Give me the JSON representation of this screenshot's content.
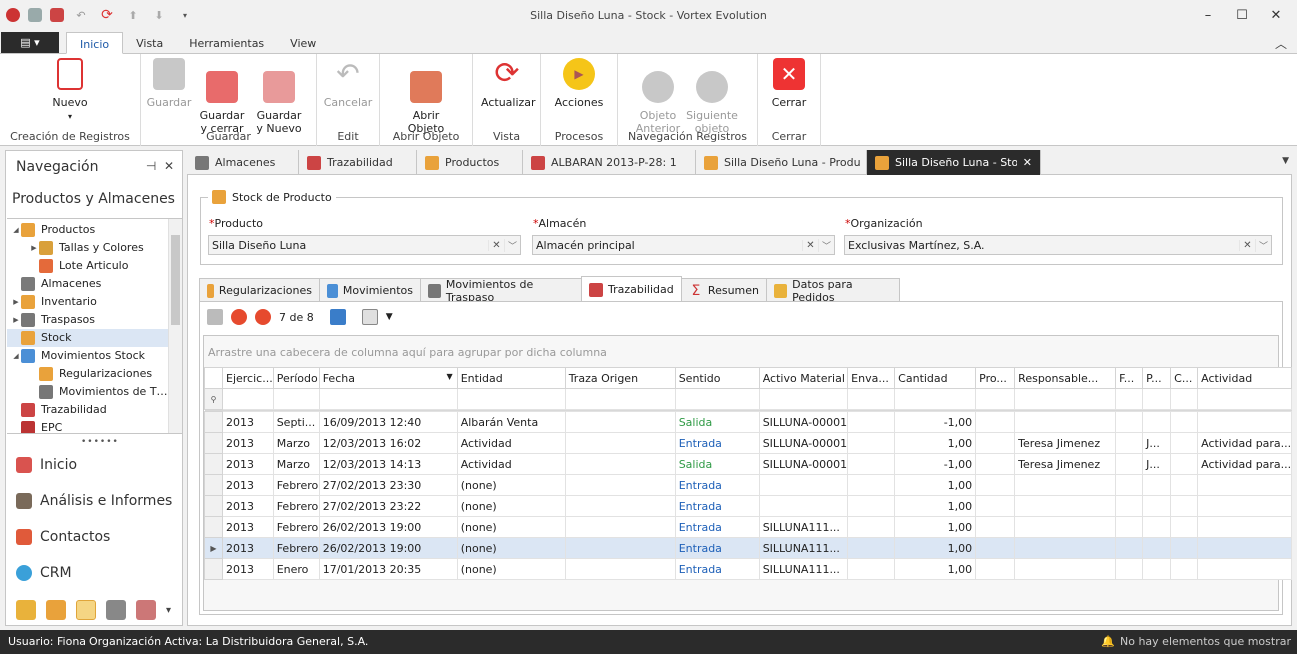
{
  "window": {
    "title": "Silla Diseño Luna - Stock - Vortex Evolution"
  },
  "menu": {
    "file_icon": "menu-icon",
    "tabs": [
      "Inicio",
      "Vista",
      "Herramientas",
      "View"
    ]
  },
  "ribbon": {
    "groups": [
      {
        "label": "Creación de Registros",
        "buttons": [
          "Nuevo"
        ]
      },
      {
        "label": "Guardar",
        "buttons": [
          "Guardar",
          "Guardar\ny cerrar",
          "Guardar\ny Nuevo"
        ]
      },
      {
        "label": "Edit",
        "buttons": [
          "Cancelar"
        ]
      },
      {
        "label": "Abrir Objeto",
        "buttons": [
          "Abrir\nObjeto"
        ]
      },
      {
        "label": "Vista",
        "buttons": [
          "Actualizar"
        ]
      },
      {
        "label": "Procesos",
        "buttons": [
          "Acciones"
        ]
      },
      {
        "label": "Navegación Registros",
        "buttons": [
          "Objeto\nAnterior",
          "Siguiente\nobjeto"
        ]
      },
      {
        "label": "Cerrar",
        "buttons": [
          "Cerrar"
        ]
      }
    ]
  },
  "nav": {
    "title": "Navegación",
    "section": "Productos y Almacenes",
    "tree": [
      "Productos",
      "Tallas y Colores",
      "Lote Articulo",
      "Almacenes",
      "Inventario",
      "Traspasos",
      "Stock",
      "Movimientos Stock",
      "Regularizaciones",
      "Movimientos de T…",
      "Trazabilidad",
      "EPC"
    ],
    "buttons": [
      "Inicio",
      "Análisis e Informes",
      "Contactos",
      "CRM"
    ]
  },
  "doc_tabs": [
    "Almacenes",
    "Trazabilidad",
    "Productos",
    "ALBARAN 2013-P-28: 1",
    "Silla Diseño Luna - Produ",
    "Silla Diseño Luna - Stock"
  ],
  "form": {
    "group_title": "Stock de Producto",
    "producto_label": "Producto",
    "producto_value": "Silla Diseño Luna",
    "almacen_label": "Almacén",
    "almacen_value": "Almacén principal",
    "org_label": "Organización",
    "org_value": "Exclusivas Martínez, S.A."
  },
  "sub_tabs": [
    "Regularizaciones",
    "Movimientos",
    "Movimientos de Traspaso",
    "Trazabilidad",
    "Resumen",
    "Datos para Pedidos"
  ],
  "grid": {
    "counter": "7 de 8",
    "group_hint": "Arrastre una cabecera de columna aquí para agrupar por dicha columna",
    "columns": [
      "Ejercic...",
      "Período",
      "Fecha",
      "Entidad",
      "Traza Origen",
      "Sentido",
      "Activo Material",
      "Enva...",
      "Cantidad",
      "Pro...",
      "Responsable...",
      "F...",
      "P...",
      "C...",
      "Actividad"
    ],
    "rows": [
      [
        "2013",
        "Septi...",
        "16/09/2013 12:40",
        "Albarán Venta",
        "",
        "Salida",
        "SILLUNA-00001",
        "",
        "-1,00",
        "",
        "",
        "",
        "",
        "",
        ""
      ],
      [
        "2013",
        "Marzo",
        "12/03/2013 16:02",
        "Actividad",
        "",
        "Entrada",
        "SILLUNA-00001",
        "",
        "1,00",
        "",
        "Teresa Jimenez",
        "",
        "J...",
        "",
        "Actividad para..."
      ],
      [
        "2013",
        "Marzo",
        "12/03/2013 14:13",
        "Actividad",
        "",
        "Salida",
        "SILLUNA-00001",
        "",
        "-1,00",
        "",
        "Teresa Jimenez",
        "",
        "J...",
        "",
        "Actividad para..."
      ],
      [
        "2013",
        "Febrero",
        "27/02/2013 23:30",
        "(none)",
        "",
        "Entrada",
        "",
        "",
        "1,00",
        "",
        "",
        "",
        "",
        "",
        ""
      ],
      [
        "2013",
        "Febrero",
        "27/02/2013 23:22",
        "(none)",
        "",
        "Entrada",
        "",
        "",
        "1,00",
        "",
        "",
        "",
        "",
        "",
        ""
      ],
      [
        "2013",
        "Febrero",
        "26/02/2013 19:00",
        "(none)",
        "",
        "Entrada",
        "SILLUNA111...",
        "",
        "1,00",
        "",
        "",
        "",
        "",
        "",
        ""
      ],
      [
        "2013",
        "Febrero",
        "26/02/2013 19:00",
        "(none)",
        "",
        "Entrada",
        "SILLUNA111...",
        "",
        "1,00",
        "",
        "",
        "",
        "",
        "",
        ""
      ],
      [
        "2013",
        "Enero",
        "17/01/2013 20:35",
        "(none)",
        "",
        "Entrada",
        "SILLUNA111...",
        "",
        "1,00",
        "",
        "",
        "",
        "",
        "",
        ""
      ]
    ],
    "focused_row": 6
  },
  "status": {
    "user": "Usuario: Fiona",
    "org": "Organización Activa: La Distribuidora General, S.A.",
    "notifications": "No hay elementos que mostrar"
  },
  "colors": {
    "accent": "#1e5aa8",
    "salida": "#2f9a45",
    "entrada": "#1e60b8",
    "dark": "#2b2b2b"
  }
}
